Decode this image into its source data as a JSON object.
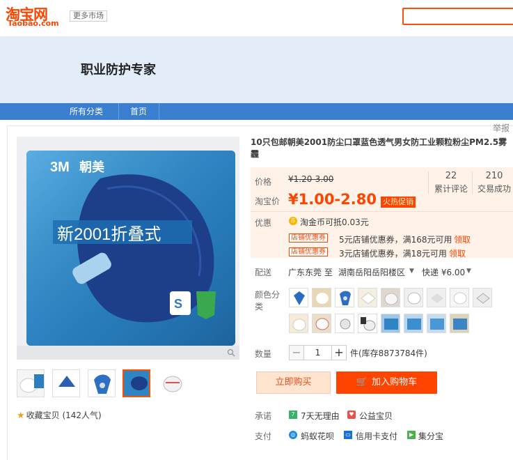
{
  "header": {
    "logo_cn": "淘宝网",
    "logo_en": "Taobao.com",
    "more_market": "更多市场",
    "search_placeholder": ""
  },
  "shop": {
    "title": "职业防护专家",
    "nav": [
      "所有分类",
      "首页"
    ]
  },
  "report_label": "举报",
  "product": {
    "title": "10只包邮朝美2001防尘口罩蓝色透气男女防工业颗粒粉尘PM2.5雾霾",
    "price_label": "价格",
    "price_original": "¥1.20-3.00",
    "tb_price_label": "淘宝价",
    "tb_price": "¥1.00-2.80",
    "hot_tag": "火热促销",
    "reviews_count": "22",
    "reviews_label": "累计评论",
    "sales_count": "210",
    "sales_label": "交易成功",
    "promo_label": "优惠",
    "coin_text": "淘金币可抵0.03元",
    "coupons": [
      {
        "tag": "店铺优惠券",
        "text": "5元店铺优惠券，满168元可用",
        "link": "领取"
      },
      {
        "tag": "店铺优惠券",
        "text": "3元店铺优惠券，满18元可用",
        "link": "领取"
      }
    ],
    "shipping_label": "配送",
    "shipping_from": "广东东莞 至",
    "shipping_to": "湖南岳阳岳阳楼区",
    "shipping_method": "快递 ¥6.00",
    "color_label": "颜色分类",
    "quantity_label": "数量",
    "quantity_value": "1",
    "stock_text": "件(库存8873784件)",
    "buy_now": "立即购买",
    "add_cart": "加入购物车",
    "favorite_text": "收藏宝贝 (142人气)",
    "promise_label": "承诺",
    "promises": [
      "7天无理由",
      "公益宝贝"
    ],
    "payment_label": "支付",
    "payments": [
      "蚂蚁花呗",
      "信用卡支付",
      "集分宝"
    ],
    "package_brand": "朝美",
    "package_model": "新2001折叠式"
  },
  "colors": {
    "accent": "#ff4400",
    "nav_blue": "#3a7ed0",
    "banner_bg": "#e3ecf9",
    "price_panel_bg": "#fff2e8"
  }
}
